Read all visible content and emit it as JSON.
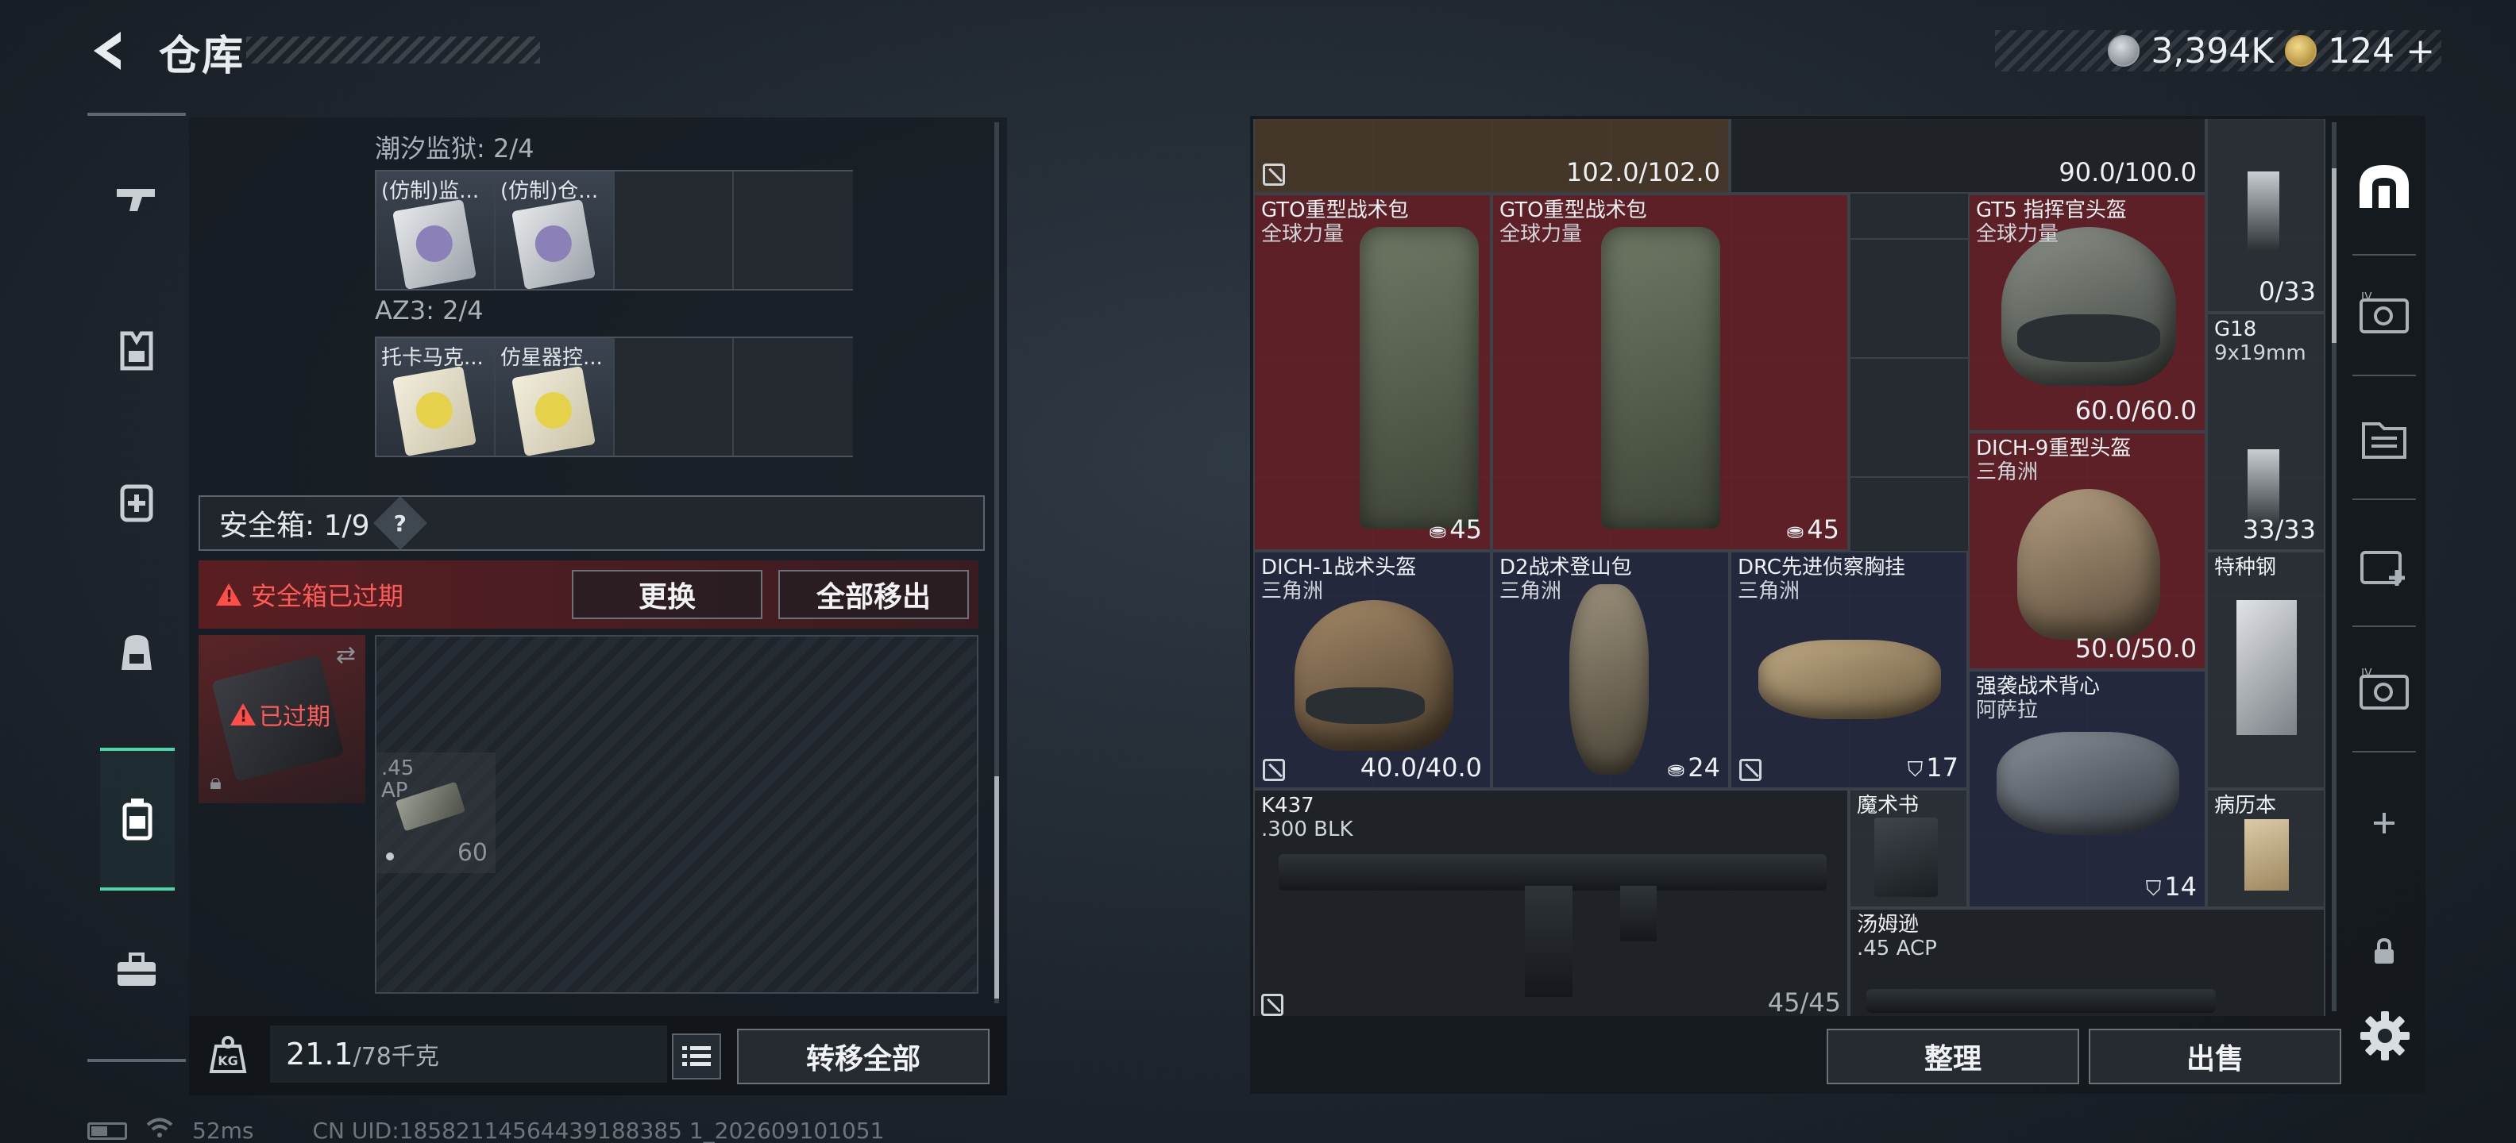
{
  "header": {
    "title": "仓库",
    "silver_amount": "3,394K",
    "gold_amount": "124",
    "gold_plus": "+"
  },
  "left_nav": {
    "items": [
      "weapon-icon",
      "vest-icon",
      "medkit-icon",
      "backpack-icon",
      "secure-box-icon",
      "toolbox-icon"
    ],
    "active_index": 4
  },
  "stash": {
    "groups": [
      {
        "label": "潮汐监狱: 2/4",
        "slots": [
          {
            "name": "(仿制)监...",
            "color": "grey"
          },
          {
            "name": "(仿制)仓...",
            "color": "grey"
          }
        ]
      },
      {
        "label": "AZ3: 2/4",
        "slots": [
          {
            "name": "托卡马克...",
            "color": "yellow"
          },
          {
            "name": "仿星器控...",
            "color": "yellow"
          }
        ]
      }
    ]
  },
  "secure": {
    "label": "安全箱: 1/9",
    "help": "?",
    "expired_message": "安全箱已过期",
    "replace_label": "更换",
    "move_all_out_label": "全部移出",
    "expired_tag": "已过期",
    "ammo": {
      "name_line1": ".45",
      "name_line2": "AP",
      "count": "60"
    }
  },
  "weight": {
    "current": "21.1",
    "max": "/78千克"
  },
  "bottom_left": {
    "transfer_all_label": "转移全部"
  },
  "status": {
    "ping": "52ms",
    "uid": "CN UID:18582114564439188385 1_202609101051"
  },
  "inventory": {
    "top_row": {
      "left_value": "102.0/102.0",
      "right_value": "90.0/100.0"
    },
    "items": {
      "gto1": {
        "name": "GTO重型战术包",
        "sub": "全球力量",
        "value": "45"
      },
      "gto2": {
        "name": "GTO重型战术包",
        "sub": "全球力量",
        "value": "45"
      },
      "gt5": {
        "name": "GT5 指挥官头盔",
        "sub": "全球力量",
        "value": "60.0/60.0"
      },
      "mag1": {
        "value": "0/33"
      },
      "g18": {
        "name": "G18",
        "sub": "9x19mm"
      },
      "dich9": {
        "name": "DICH-9重型头盔",
        "sub": "三角洲",
        "value": "50.0/50.0"
      },
      "mag2": {
        "value": "33/33"
      },
      "dich1": {
        "name": "DICH-1战术头盔",
        "sub": "三角洲",
        "value": "40.0/40.0"
      },
      "d2": {
        "name": "D2战术登山包",
        "sub": "三角洲",
        "value": "24"
      },
      "drc": {
        "name": "DRC先进侦察胸挂",
        "sub": "三角洲",
        "value": "17"
      },
      "steel": {
        "name": "特种钢"
      },
      "vest": {
        "name": "强袭战术背心",
        "sub": "阿萨拉",
        "value": "14"
      },
      "k437": {
        "name": "K437",
        "sub": ".300 BLK",
        "value": "45/45"
      },
      "book": {
        "name": "魔术书"
      },
      "record": {
        "name": "病历本"
      },
      "thompson": {
        "name": "汤姆逊",
        "sub": ".45 ACP"
      }
    },
    "sort_label": "整理",
    "sell_label": "出售"
  },
  "right_nav": {
    "items": [
      "dome-icon",
      "key-card-icon",
      "folder-icon",
      "medical-case-icon",
      "key-card-icon-2",
      "add-icon",
      "lock-icon"
    ]
  },
  "colors": {
    "accent_green": "#4fd6a6",
    "alert_red": "#ff5a55",
    "tile_red": "#622026",
    "tile_blue": "#24283e"
  }
}
